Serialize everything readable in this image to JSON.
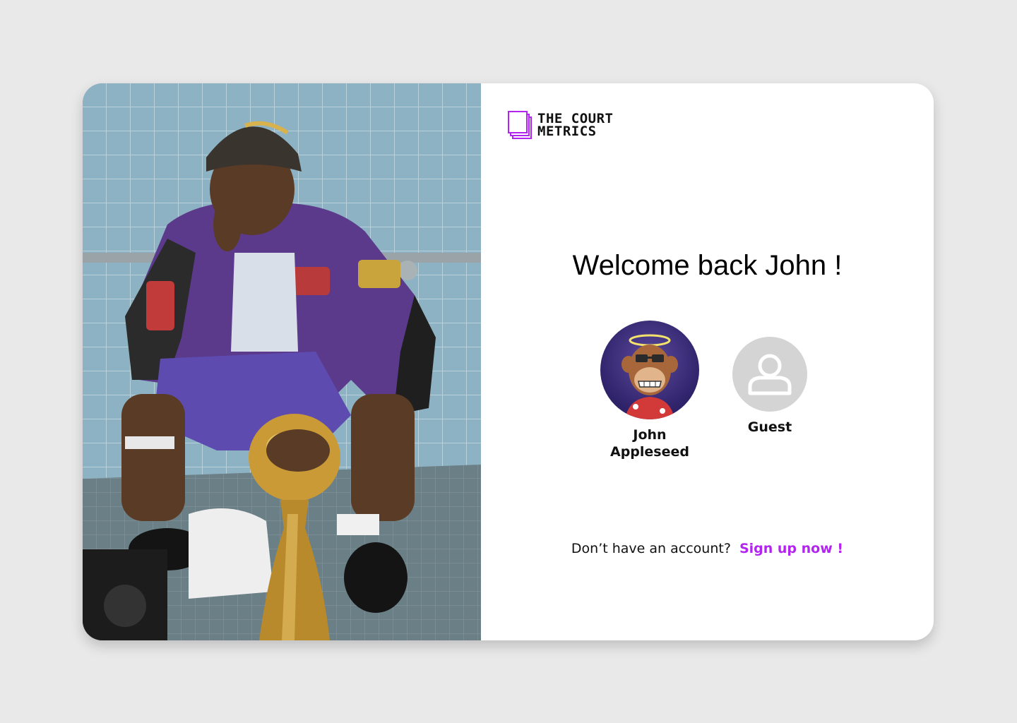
{
  "brand": {
    "logo_line1": "THE COURT",
    "logo_line2": "METRICS",
    "accent_color": "#b224ef"
  },
  "welcome": {
    "title": "Welcome back John !"
  },
  "profiles": [
    {
      "name": "John Appleseed",
      "avatar": "ape-avatar"
    },
    {
      "name": "Guest",
      "avatar": "user-icon"
    }
  ],
  "signup": {
    "prompt": "Don’t have an account?",
    "link_label": "Sign up now !"
  },
  "hero_image": {
    "subject": "basketball-player-with-trophy-photo"
  }
}
